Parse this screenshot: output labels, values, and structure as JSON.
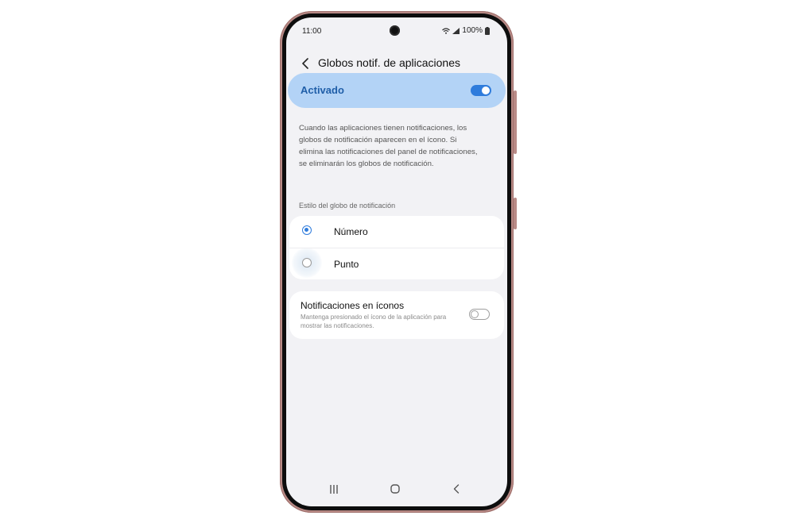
{
  "status_bar": {
    "time": "11:00",
    "battery_text": "100%",
    "icons": [
      "wifi-icon",
      "signal-icon",
      "battery-icon"
    ]
  },
  "header": {
    "title": "Globos notif. de aplicaciones",
    "back_icon": "chevron-left-icon"
  },
  "master_switch": {
    "label": "Activado",
    "state": true,
    "accent_color": "#2f7cdc",
    "background_color": "#b3d3f6"
  },
  "description": "Cuando las aplicaciones tienen notificaciones, los globos de notificación aparecen en el ícono. Si elimina las notificaciones del panel de notificaciones, se eliminarán los globos de notificación.",
  "badge_style": {
    "section_title": "Estilo del globo de notificación",
    "options": [
      {
        "label": "Número",
        "selected": true
      },
      {
        "label": "Punto",
        "selected": false
      }
    ]
  },
  "icon_notifications": {
    "title": "Notificaciones en íconos",
    "subtitle": "Mantenga presionado el ícono de la aplicación para mostrar las notificaciones.",
    "state": false
  },
  "nav_bar": {
    "buttons": [
      "recents-icon",
      "home-icon",
      "back-icon"
    ]
  }
}
